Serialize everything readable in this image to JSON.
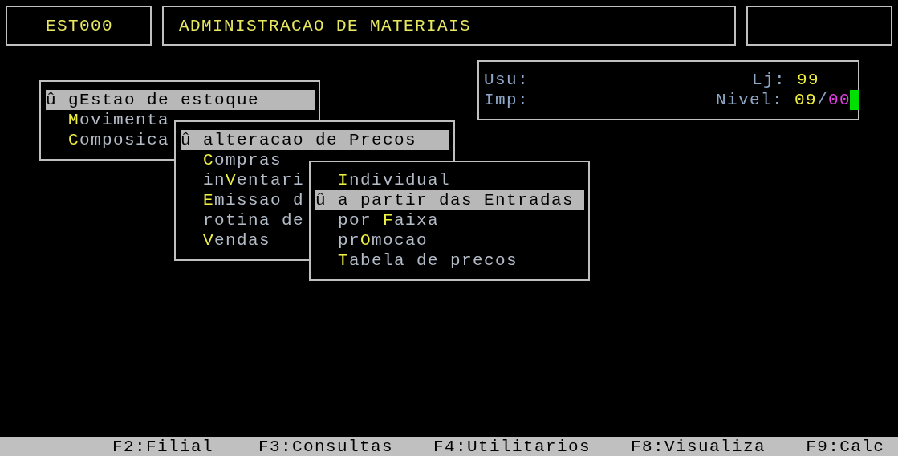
{
  "header": {
    "code": "EST000",
    "title": "ADMINISTRACAO DE MATERIAIS"
  },
  "info": {
    "user_label": "Usu:",
    "printer_label": "Imp:",
    "store_label": "Lj:",
    "store": "99",
    "level_label": "Nivel:",
    "level": "09",
    "separator": "/",
    "sublevel": "00"
  },
  "menus": [
    {
      "mark": "û",
      "items": [
        {
          "pre": "g",
          "key": "E",
          "post": "stao de estoque",
          "selected": true
        },
        {
          "key": "M",
          "post": "ovimenta",
          "selected": false
        },
        {
          "key": "C",
          "post": "omposica",
          "selected": false
        }
      ]
    },
    {
      "mark": "û",
      "items": [
        {
          "text": "alteracao de Precos",
          "selected": true
        },
        {
          "key": "C",
          "post": "ompras",
          "selected": false
        },
        {
          "pre": "in",
          "key": "V",
          "post": "entari",
          "selected": false
        },
        {
          "key": "E",
          "post": "missao d",
          "selected": false
        },
        {
          "text": "rotina de",
          "selected": false
        },
        {
          "key": "V",
          "post": "endas",
          "selected": false
        }
      ]
    },
    {
      "mark": "û",
      "items": [
        {
          "key": "I",
          "post": "ndividual",
          "selected": false
        },
        {
          "text": "a partir das Entradas",
          "selected": true
        },
        {
          "pre": "por ",
          "key": "F",
          "post": "aixa",
          "selected": false
        },
        {
          "pre": "pr",
          "key": "O",
          "post": "mocao",
          "selected": false
        },
        {
          "key": "T",
          "post": "abela de precos",
          "selected": false
        }
      ]
    }
  ],
  "function_keys": [
    "F2:Filial",
    "F3:Consultas",
    "F4:Utilitarios",
    "F8:Visualiza",
    "F9:Calc"
  ]
}
